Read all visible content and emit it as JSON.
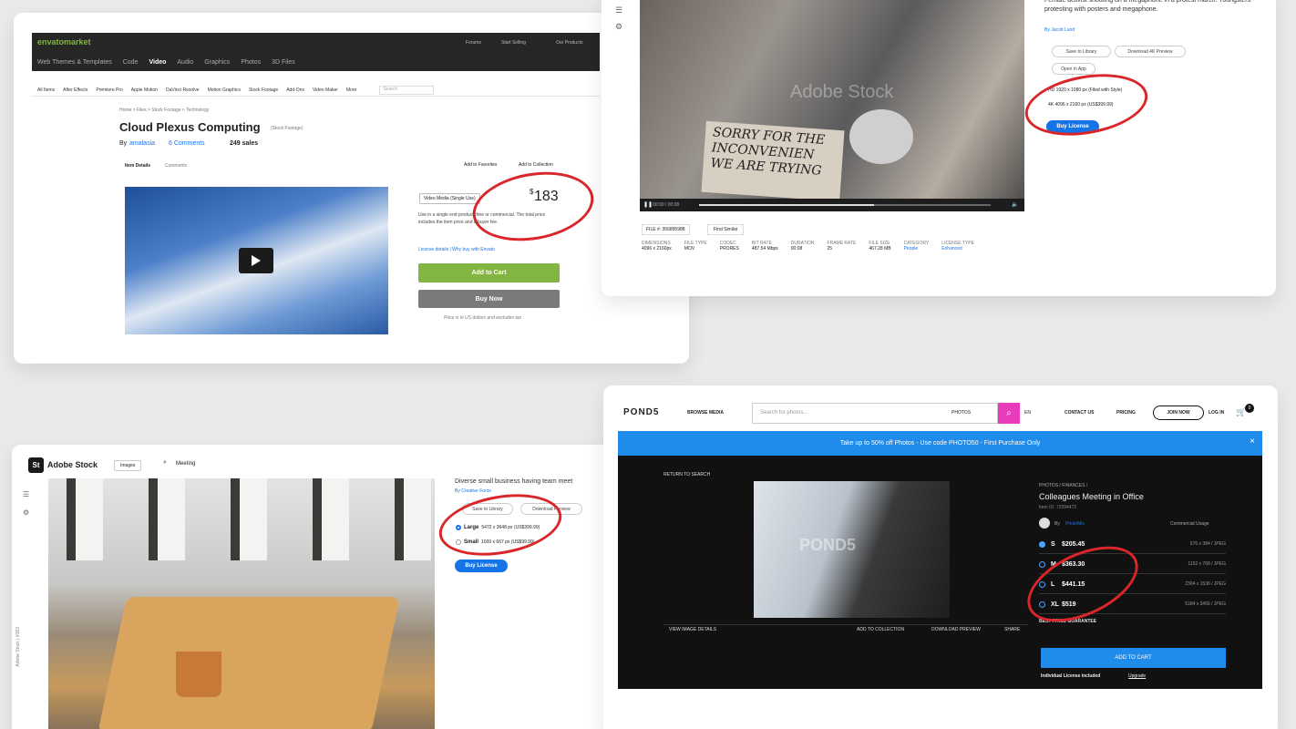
{
  "envato": {
    "logo": "envatomarket",
    "top_links": [
      "Forums",
      "Start Selling",
      "Our Products"
    ],
    "nav": [
      "Web Themes & Templates",
      "Code",
      "Video",
      "Audio",
      "Graphics",
      "Photos",
      "3D Files"
    ],
    "nav_active": "Video",
    "sub_nav": [
      "All Items",
      "After Effects",
      "Premiere Pro",
      "Apple Motion",
      "DaVinci Resolve",
      "Motion Graphics",
      "Stock Footage",
      "Add-Ons",
      "Video Maker",
      "More"
    ],
    "search_placeholder": "Search",
    "breadcrumb": "Home  >  Files  >  Stock Footage  >  Technology",
    "title": "Cloud Plexus Computing",
    "title_tag": "(Stock Footage)",
    "author_prefix": "By",
    "author": "amalasia",
    "comments": "6 Comments",
    "sales": "249 sales",
    "tabs": [
      "Item Details",
      "Comments"
    ],
    "favorites": "Add to Favorites",
    "collection": "Add to Collection",
    "license_select": "Video Media (Single Use)",
    "price_symbol": "$",
    "price": "183",
    "license_text": "Use in a single end product, free or commercial. The total price includes the item price and a buyer fee.",
    "license_link": "License details | Why buy with Envato",
    "add_to_cart": "Add to Cart",
    "buy_now": "Buy Now",
    "tax_note": "Price is in US dollars and excludes tax"
  },
  "protest": {
    "desc": "Female activist shouting on a megaphone in a protest march. Youngsters protesting with posters and megaphone.",
    "by": "By Jacob Lund",
    "save": "Save to Library",
    "download": "Download 4K Preview",
    "open": "Open in App",
    "option1": "HD 1920 x 1080 px (Filed with Style)",
    "option2": "4K 4096 x 2160 px (US$399.99)",
    "buy": "Buy License",
    "watermark": "Adobe Stock",
    "sign_text": [
      "SORRY FOR THE",
      "INCONVENIEN",
      "WE ARE TRYING"
    ],
    "time": "00:00 / 00:08",
    "file_label": "FILE #: 356895988",
    "find_similar": "Find Similar",
    "meta": [
      {
        "k": "DIMENSIONS",
        "v": "4096 x 2160px"
      },
      {
        "k": "FILE TYPE",
        "v": "MOV"
      },
      {
        "k": "CODEC",
        "v": "PRORES"
      },
      {
        "k": "BIT RATE",
        "v": "487.54 Mbps"
      },
      {
        "k": "DURATION",
        "v": "00:08"
      },
      {
        "k": "FRAME RATE",
        "v": "25"
      },
      {
        "k": "FILE SIZE",
        "v": "467.28 MB"
      },
      {
        "k": "CATEGORY",
        "v": "People"
      },
      {
        "k": "LICENSE TYPE",
        "v": "Enhanced"
      }
    ]
  },
  "meeting": {
    "logo_mark": "St",
    "logo": "Adobe Stock",
    "scope": "Images",
    "search": "Meeting",
    "title": "Diverse small business having team meet",
    "by": "By Creative Force",
    "save": "Save to Library",
    "download": "Download Preview",
    "large": "Large",
    "large_detail": "5472 x 3648 px (US$399.99)",
    "small": "Small",
    "small_detail": "1000 x 667 px (US$99.99)",
    "buy": "Buy License",
    "side_credit": "Adobe Stock | #383"
  },
  "pond5": {
    "logo": "POND5",
    "browse": "BROWSE MEDIA",
    "search_placeholder": "Search for photos...",
    "scope": "PHOTOS",
    "lang": "EN",
    "contact": "CONTACT US",
    "pricing": "PRICING",
    "join": "JOIN NOW",
    "login": "LOG IN",
    "cart_count": "0",
    "promo": "Take up to 50% off Photos - Use code PHOTO50 - First Purchase Only",
    "close": "×",
    "return": "RETURN TO SEARCH",
    "category": "PHOTOS / FINANCES /",
    "title": "Colleagues Meeting in Office",
    "id": "Item ID: 72594472",
    "by_prefix": "By",
    "author": "PhotoMix",
    "commercial": "Commercial Usage",
    "watermark": "POND5",
    "rows": [
      {
        "size": "S",
        "price": "$205.45",
        "dim": "576 x 384 / JPEG"
      },
      {
        "size": "M",
        "price": "$363.30",
        "dim": "1152 x 768 / JPEG"
      },
      {
        "size": "L",
        "price": "$441.15",
        "dim": "2304 x 1536 / JPEG"
      },
      {
        "size": "XL",
        "price": "$519",
        "dim": "5184 x 3456 / JPEG"
      }
    ],
    "guarantee": "BEST PRICE GUARANTEE",
    "view_details": "VIEW IMAGE DETAILS",
    "add_collection": "ADD TO COLLECTION",
    "download_preview": "DOWNLOAD PREVIEW",
    "share": "SHARE",
    "add_cart": "ADD TO CART",
    "license": "Individual License included",
    "upgrade": "Upgrade"
  },
  "colors": {
    "annotation": "#d9262a",
    "envato_green": "#82b541",
    "adobe_blue": "#1473e6",
    "pond5_blue": "#1f8bea"
  }
}
